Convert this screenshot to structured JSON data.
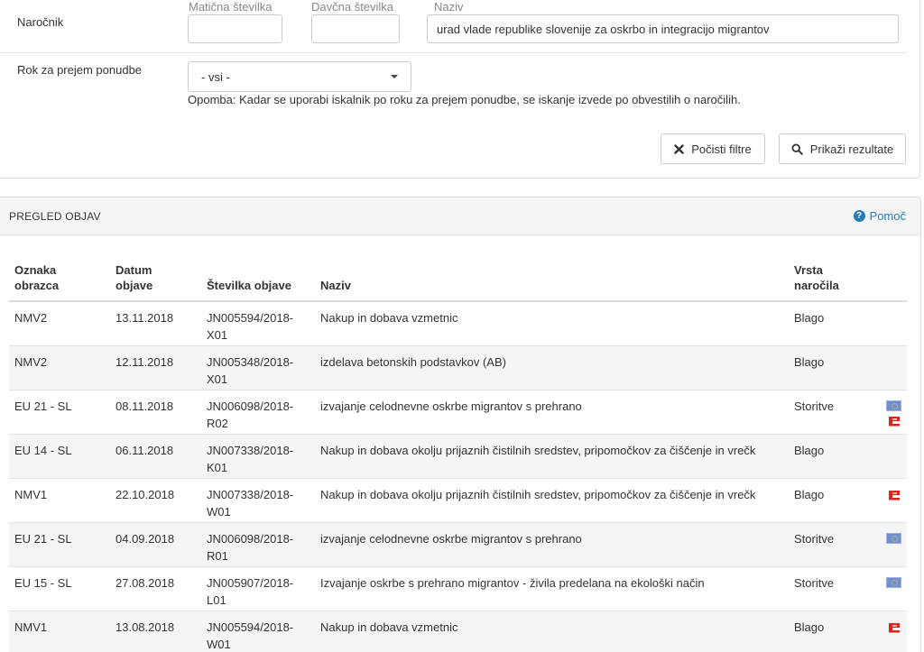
{
  "filters": {
    "narocnik_label": "Naročnik",
    "maticna_label": "Matična številka",
    "davcna_label": "Davčna številka",
    "naziv_label": "Naziv",
    "maticna_value": "",
    "davcna_value": "",
    "naziv_value": "urad vlade republike slovenije za oskrbo in integracijo migrantov",
    "rok_label": "Rok za prejem ponudbe",
    "rok_selected": "- vsi -",
    "note": "Opomba: Kadar se uporabi iskalnik po roku za prejem ponudbe, se iskanje izvede po obvestilih o naročilih.",
    "clear_button": "Počisti filtre",
    "show_button": "Prikaži rezultate"
  },
  "results": {
    "title": "PREGLED OBJAV",
    "help_label": "Pomoč",
    "columns": {
      "oznaka_1": "Oznaka",
      "oznaka_2": "obrazca",
      "datum_1": "Datum",
      "datum_2": "objave",
      "stevilka": "Številka objave",
      "naziv": "Naziv",
      "vrsta_1": "Vrsta",
      "vrsta_2": "naročila"
    },
    "rows": [
      {
        "oznaka": "NMV2",
        "datum": "13.11.2018",
        "stevilka_1": "JN005594/2018-",
        "stevilka_2": "X01",
        "naziv": "Nakup in dobava vzmetnic",
        "vrsta": "Blago",
        "eu": false,
        "enarocanje": false
      },
      {
        "oznaka": "NMV2",
        "datum": "12.11.2018",
        "stevilka_1": "JN005348/2018-",
        "stevilka_2": "X01",
        "naziv": "izdelava betonskih podstavkov (AB)",
        "vrsta": "Blago",
        "eu": false,
        "enarocanje": false
      },
      {
        "oznaka": "EU 21 - SL",
        "datum": "08.11.2018",
        "stevilka_1": "JN006098/2018-",
        "stevilka_2": "R02",
        "naziv": "izvajanje celodnevne oskrbe migrantov s prehrano",
        "vrsta": "Storitve",
        "eu": true,
        "enarocanje": true
      },
      {
        "oznaka": "EU 14 - SL",
        "datum": "06.11.2018",
        "stevilka_1": "JN007338/2018-",
        "stevilka_2": "K01",
        "naziv": "Nakup in dobava okolju prijaznih čistilnih sredstev, pripomočkov za čiščenje in vrečk",
        "vrsta": "Blago",
        "eu": false,
        "enarocanje": false
      },
      {
        "oznaka": "NMV1",
        "datum": "22.10.2018",
        "stevilka_1": "JN007338/2018-",
        "stevilka_2": "W01",
        "naziv": "Nakup in dobava okolju prijaznih čistilnih sredstev, pripomočkov za čiščenje in vrečk",
        "vrsta": "Blago",
        "eu": false,
        "enarocanje": true
      },
      {
        "oznaka": "EU 21 - SL",
        "datum": "04.09.2018",
        "stevilka_1": "JN006098/2018-",
        "stevilka_2": "R01",
        "naziv": "izvajanje celodnevne oskrbe migrantov s prehrano",
        "vrsta": "Storitve",
        "eu": true,
        "enarocanje": false
      },
      {
        "oznaka": "EU 15 - SL",
        "datum": "27.08.2018",
        "stevilka_1": "JN005907/2018-",
        "stevilka_2": "L01",
        "naziv": "Izvajanje oskrbe s prehrano migrantov - živila predelana na ekološki način",
        "vrsta": "Storitve",
        "eu": true,
        "enarocanje": false
      },
      {
        "oznaka": "NMV1",
        "datum": "13.08.2018",
        "stevilka_1": "JN005594/2018-",
        "stevilka_2": "W01",
        "naziv": "Nakup in dobava vzmetnic",
        "vrsta": "Blago",
        "eu": false,
        "enarocanje": true
      }
    ]
  },
  "colors": {
    "link": "#2a7ab7",
    "enarocanje_red": "#d9251c",
    "eu_blue": "#6f8fd1"
  }
}
